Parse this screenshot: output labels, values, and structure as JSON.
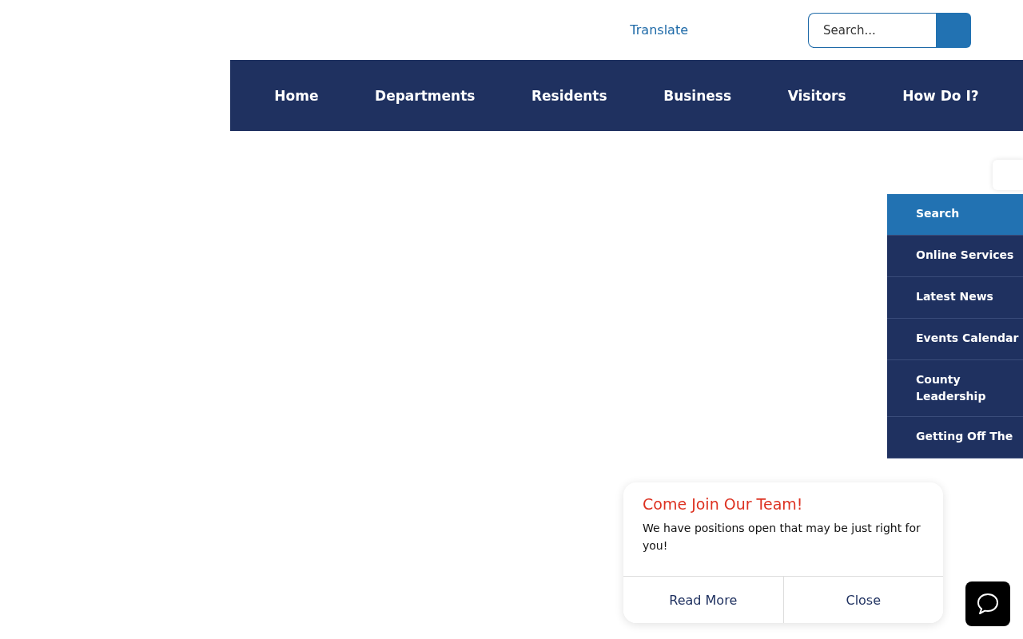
{
  "header": {
    "translate_link": "Translate",
    "search": {
      "placeholder": "Search..."
    }
  },
  "nav": {
    "items": [
      {
        "label": "Home"
      },
      {
        "label": "Departments"
      },
      {
        "label": "Residents"
      },
      {
        "label": "Business"
      },
      {
        "label": "Visitors"
      },
      {
        "label": "How Do I?"
      }
    ]
  },
  "side_menu": {
    "items": [
      {
        "label": "Search",
        "selected": true
      },
      {
        "label": "Online Services",
        "selected": false
      },
      {
        "label": "Latest News",
        "selected": false
      },
      {
        "label": "Events Calendar",
        "selected": false
      },
      {
        "label": "County Leadership",
        "selected": false
      },
      {
        "label": "Getting Off The",
        "selected": false
      }
    ]
  },
  "popup": {
    "title": "Come Join Our Team!",
    "message": "We have positions open that may be just right for you!",
    "buttons": [
      "Read More",
      "Close"
    ]
  }
}
